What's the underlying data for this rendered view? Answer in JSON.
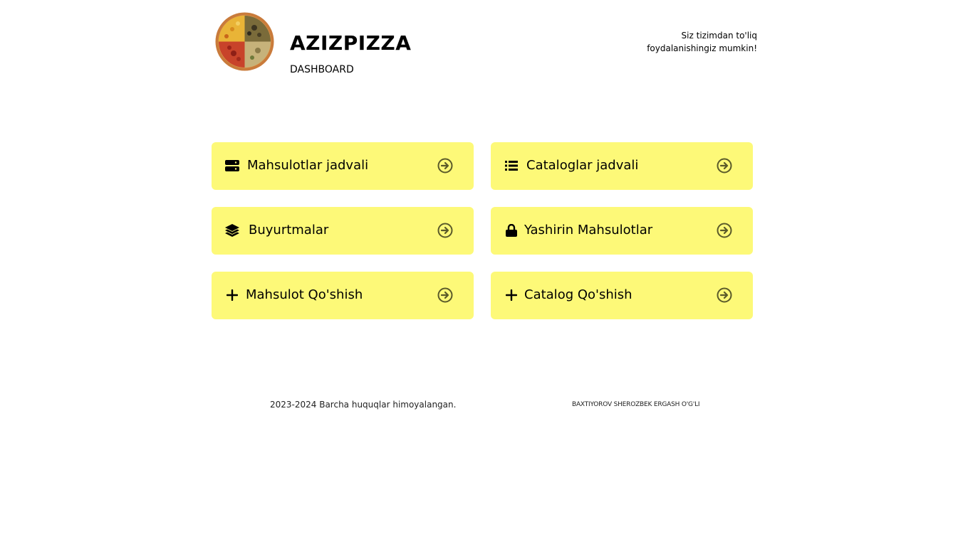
{
  "header": {
    "logo_icon": "pizza-logo-icon",
    "title": "AZIZPIZZA",
    "subtitle": "DASHBOARD",
    "note": "Siz tizimdan to'liq foydalanishingiz mumkin!"
  },
  "cards": [
    {
      "label": "Mahsulotlar jadvali",
      "icon": "table-icon"
    },
    {
      "label": "Cataloglar jadvali",
      "icon": "list-icon"
    },
    {
      "label": "Buyurtmalar",
      "icon": "layers-icon"
    },
    {
      "label": "Yashirin Mahsulotlar",
      "icon": "lock-icon"
    },
    {
      "label": "Mahsulot Qo'shish",
      "icon": "plus-icon"
    },
    {
      "label": "Catalog Qo'shish",
      "icon": "plus-icon"
    }
  ],
  "footer": {
    "copyright": "2023-2024 Barcha huquqlar himoyalangan.",
    "author": "BAXTIYOROV SHEROZBEK ERGASH O'G'LI"
  },
  "colors": {
    "card_bg": "#fdf978",
    "arrow": "#5a5a2a"
  }
}
